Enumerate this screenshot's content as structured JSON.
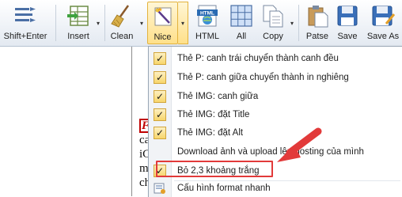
{
  "toolbar": {
    "buttons": [
      {
        "id": "shift-enter",
        "label": "Shift+Enter",
        "icon": "align-arrows-icon"
      },
      {
        "id": "insert",
        "label": "Insert",
        "icon": "insert-table-icon"
      },
      {
        "id": "clean",
        "label": "Clean",
        "icon": "broom-icon"
      },
      {
        "id": "nice",
        "label": "Nice",
        "icon": "magic-wand-icon"
      },
      {
        "id": "html",
        "label": "HTML",
        "icon": "html-globe-icon"
      },
      {
        "id": "all",
        "label": "All",
        "icon": "select-all-grid-icon"
      },
      {
        "id": "copy",
        "label": "Copy",
        "icon": "copy-icon"
      },
      {
        "id": "patse",
        "label": "Patse",
        "icon": "paste-icon"
      },
      {
        "id": "save",
        "label": "Save",
        "icon": "floppy-icon"
      },
      {
        "id": "save-as",
        "label": "Save As",
        "icon": "floppy-pencil-icon"
      }
    ],
    "icon_html_text": "HTML"
  },
  "document": {
    "fragment_red": "F",
    "lines": [
      "ca",
      "iC",
      "m",
      "ch"
    ]
  },
  "menu": {
    "items": [
      {
        "label": "Thẻ P: canh trái chuyển thành canh đều",
        "checked": true
      },
      {
        "label": "Thẻ P: canh giữa chuyển thành in nghiêng",
        "checked": true
      },
      {
        "label": "Thẻ IMG: canh giữa",
        "checked": true
      },
      {
        "label": "Thẻ IMG: đặt Title",
        "checked": true
      },
      {
        "label": "Thẻ IMG: đặt Alt",
        "checked": true
      },
      {
        "label": "Download ảnh và upload lên hosting của mình",
        "checked": false
      },
      {
        "label": "Bỏ 2,3 khoảng trắng",
        "checked": true
      },
      {
        "label": "Cấu hình format nhanh",
        "checked": false,
        "icon": "settings-icon"
      }
    ]
  },
  "colors": {
    "accent_highlight": "#e23a3a",
    "checked_bg": "#f7d56b",
    "toolbar_bg": "#eef2f7"
  }
}
